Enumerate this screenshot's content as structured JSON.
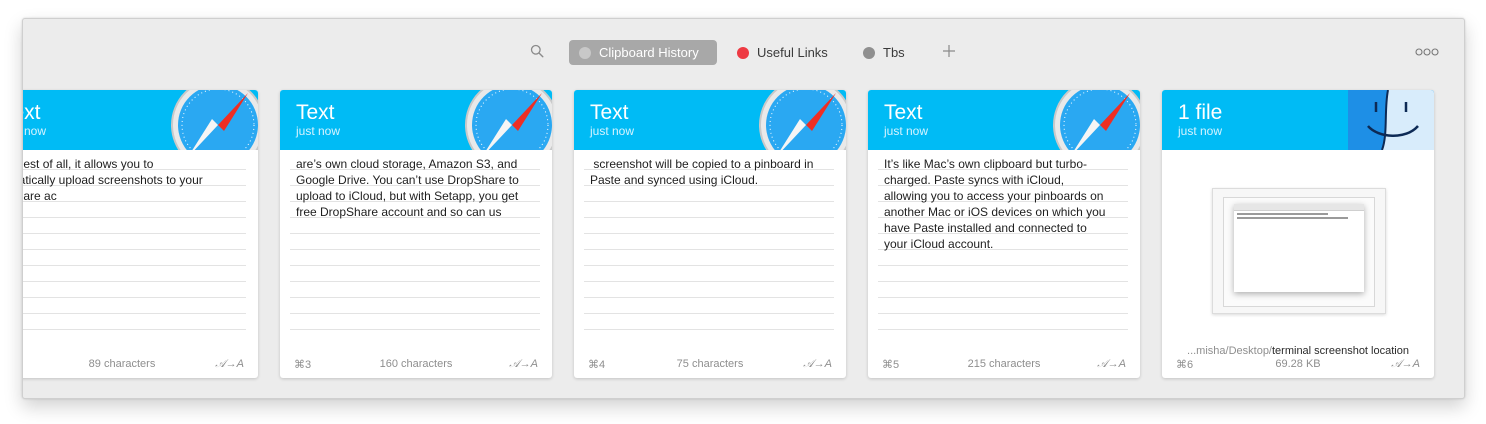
{
  "toolbar": {
    "search_icon": "search-icon",
    "tabs": [
      {
        "label": "Clipboard History",
        "color": "#c8c8c8",
        "active": true
      },
      {
        "label": "Useful Links",
        "color": "#ee3a43",
        "active": false
      },
      {
        "label": "Tbs",
        "color": "#8f8f8f",
        "active": false
      }
    ],
    "add_icon": "plus-icon",
    "more_icon": "ellipsis-icon"
  },
  "colors": {
    "card_header": "#00bbf5",
    "window_bg": "#ececec"
  },
  "cards": [
    {
      "type": "Text",
      "time": "just now",
      "app_icon": "safari-icon",
      "text": "d. Best of all, it allows you to\nomatically upload screenshots to your\npShare ac",
      "shortcut": "",
      "count": "89 characters",
      "format": "𝒜→A"
    },
    {
      "type": "Text",
      "time": "just now",
      "app_icon": "safari-icon",
      "text": "are’s own cloud storage, Amazon S3, and\nGoogle Drive. You can’t use DropShare to\nupload to iCloud, but with Setapp, you get\nfree DropShare account and so can us",
      "shortcut": "⌘3",
      "count": "160 characters",
      "format": "𝒜→A"
    },
    {
      "type": "Text",
      "time": "just now",
      "app_icon": "safari-icon",
      "text": " screenshot will be copied to a pinboard in\nPaste and synced using iCloud.",
      "shortcut": "⌘4",
      "count": "75 characters",
      "format": "𝒜→A"
    },
    {
      "type": "Text",
      "time": "just now",
      "app_icon": "safari-icon",
      "text": "It’s like Mac’s own clipboard but turbo-\ncharged. Paste syncs with iCloud,\nallowing you to access your pinboards on\nanother Mac or iOS devices on which you\nhave Paste installed and connected to\nyour iCloud account.",
      "shortcut": "⌘5",
      "count": "215 characters",
      "format": "𝒜→A"
    },
    {
      "type": "1 file",
      "time": "just now",
      "app_icon": "finder-icon",
      "path_prefix": "...misha/Desktop/",
      "path_name": "terminal screenshot location",
      "shortcut": "⌘6",
      "count": "69.28 KB",
      "format": "𝒜→A"
    }
  ]
}
